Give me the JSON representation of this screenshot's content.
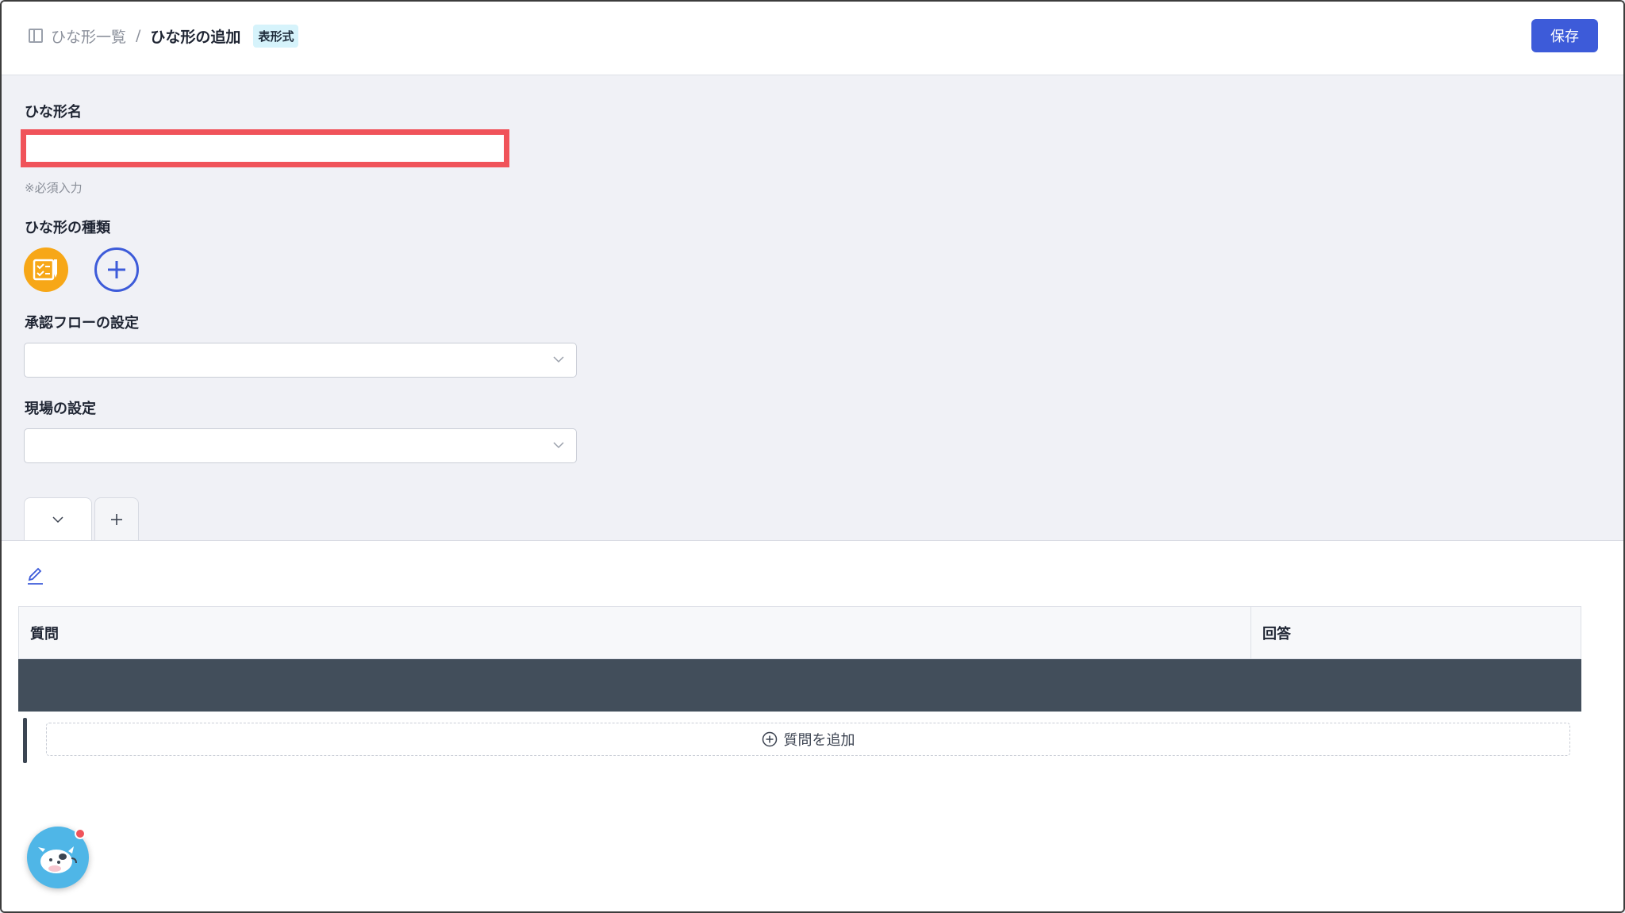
{
  "header": {
    "breadcrumb_list": "ひな形一覧",
    "breadcrumb_sep": "/",
    "breadcrumb_current": "ひな形の追加",
    "badge": "表形式",
    "save_label": "保存"
  },
  "form": {
    "name_label": "ひな形名",
    "name_value": "",
    "name_hint": "※必須入力",
    "type_label": "ひな形の種類",
    "flow_label": "承認フローの設定",
    "flow_value": "",
    "site_label": "現場の設定",
    "site_value": ""
  },
  "table": {
    "col_question": "質問",
    "col_answer": "回答",
    "add_question_label": "質問を追加"
  },
  "colors": {
    "accent": "#3d5bd9",
    "highlight": "#f0535a",
    "type_icon": "#f7a717",
    "dark_row": "#424e5b"
  },
  "icons": {
    "breadcrumb": "sidebar-panel-icon",
    "type": "checklist-document-icon",
    "add": "plus-circle-icon",
    "edit": "pencil-icon",
    "chevron": "chevron-down-icon",
    "bot": "support-bot-icon"
  }
}
